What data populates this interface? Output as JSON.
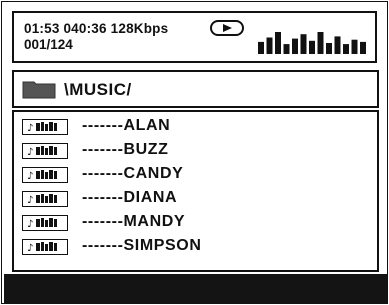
{
  "status": {
    "time_line": "01:53 040:36 128Kbps",
    "track_counter": "001/124",
    "play_icon": "play-icon",
    "equalizer_icon": "equalizer-icon",
    "equalizer_levels": [
      0.55,
      0.75,
      1.0,
      0.45,
      0.7,
      0.9,
      0.6,
      1.0,
      0.5,
      0.8,
      0.45,
      0.65,
      0.55
    ],
    "colors": {
      "foreground": "#111111",
      "background": "#ffffff"
    }
  },
  "path_bar": {
    "folder_icon": "folder-icon",
    "path": "\\MUSIC/"
  },
  "file_list": {
    "file_icon": "music-file-icon",
    "items": [
      {
        "label": "-------ALAN"
      },
      {
        "label": "-------BUZZ"
      },
      {
        "label": "-------CANDY"
      },
      {
        "label": "-------DIANA"
      },
      {
        "label": "-------MANDY"
      },
      {
        "label": "-------SIMPSON"
      }
    ]
  },
  "bottom_bar": {
    "color": "#141414"
  }
}
